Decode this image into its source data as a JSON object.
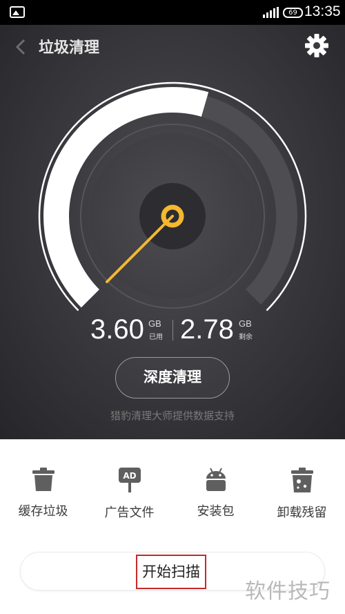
{
  "status_bar": {
    "battery": "69",
    "time": "13:35"
  },
  "header": {
    "title": "垃圾清理"
  },
  "storage": {
    "used_value": "3.60",
    "used_unit": "GB",
    "used_label": "已用",
    "free_value": "2.78",
    "free_unit": "GB",
    "free_label": "剩余",
    "used_fraction": 0.56
  },
  "deep_clean": {
    "label": "深度清理"
  },
  "credit": "猎豹清理大师提供数据支持",
  "tools": [
    {
      "label": "缓存垃圾",
      "icon": "trash-icon"
    },
    {
      "label": "广告文件",
      "icon": "ad-sign-icon"
    },
    {
      "label": "安装包",
      "icon": "android-icon"
    },
    {
      "label": "卸载残留",
      "icon": "residual-bin-icon"
    }
  ],
  "scan": {
    "label": "开始扫描"
  },
  "watermark": "软件技巧",
  "colors": {
    "accent": "#f5b82e",
    "panel": "#3a3a3f",
    "highlight_border": "#c62828"
  }
}
